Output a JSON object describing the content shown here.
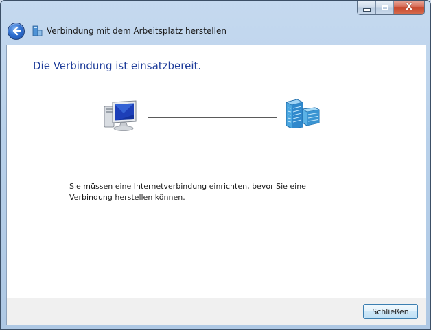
{
  "window": {
    "title": "Verbindung mit dem Arbeitsplatz herstellen",
    "caption": {
      "minimize_icon": "minimize-icon",
      "maximize_icon": "maximize-icon",
      "close_icon": "close-icon",
      "close_symbol": "X"
    }
  },
  "main": {
    "headline": "Die Verbindung ist einsatzbereit.",
    "message": "Sie müssen eine Internetverbindung einrichten, bevor Sie eine Verbindung herstellen können.",
    "left_icon": "computer-icon",
    "right_icon": "workplace-network-icon"
  },
  "footer": {
    "close_label": "Schließen"
  },
  "colors": {
    "headline": "#1f3d9a",
    "button_border": "#3c7fb1",
    "frame": "#b9d1ea"
  }
}
